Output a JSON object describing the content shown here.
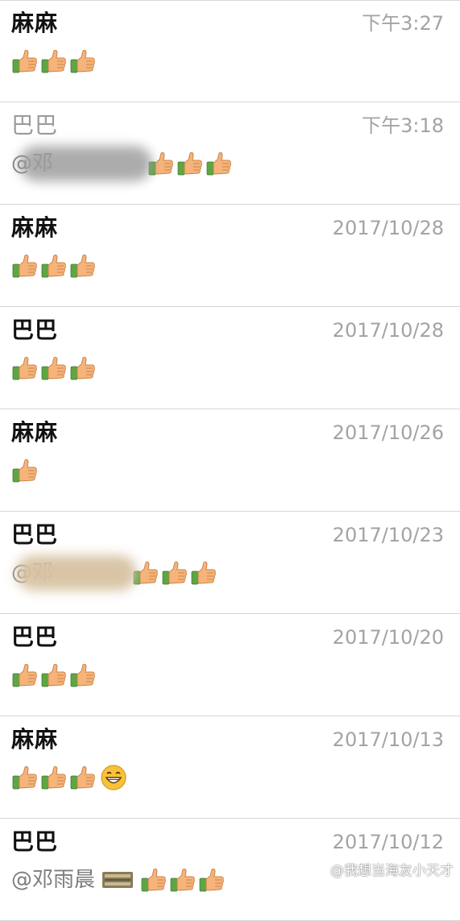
{
  "conversations": [
    {
      "sender": "麻麻",
      "time": "下午3:27",
      "message": {
        "mention": "",
        "thumbs": 3,
        "smile": false
      }
    },
    {
      "sender": "巴巴",
      "time": "下午3:18",
      "message": {
        "mention": "@邓",
        "thumbs": 3,
        "smile": false
      }
    },
    {
      "sender": "麻麻",
      "time": "2017/10/28",
      "message": {
        "mention": "",
        "thumbs": 3,
        "smile": false
      }
    },
    {
      "sender": "巴巴",
      "time": "2017/10/28",
      "message": {
        "mention": "",
        "thumbs": 3,
        "smile": false
      }
    },
    {
      "sender": "麻麻",
      "time": "2017/10/26",
      "message": {
        "mention": "",
        "thumbs": 1,
        "smile": false
      }
    },
    {
      "sender": "巴巴",
      "time": "2017/10/23",
      "message": {
        "mention": "@邓",
        "thumbs": 3,
        "smile": false
      }
    },
    {
      "sender": "巴巴",
      "time": "2017/10/20",
      "message": {
        "mention": "",
        "thumbs": 3,
        "smile": false
      }
    },
    {
      "sender": "麻麻",
      "time": "2017/10/13",
      "message": {
        "mention": "",
        "thumbs": 3,
        "smile": true
      }
    },
    {
      "sender": "巴巴",
      "time": "2017/10/12",
      "message": {
        "mention": "@邓雨晨",
        "thumbs": 3,
        "smile": false
      }
    }
  ],
  "watermark": {
    "text": "@我想当海友小天才"
  },
  "colors": {
    "sender": "#111111",
    "time": "#a3a3a3",
    "divider": "#d6d6d6",
    "thumb_skin": "#f6b47a",
    "thumb_sleeve": "#5fa544"
  }
}
